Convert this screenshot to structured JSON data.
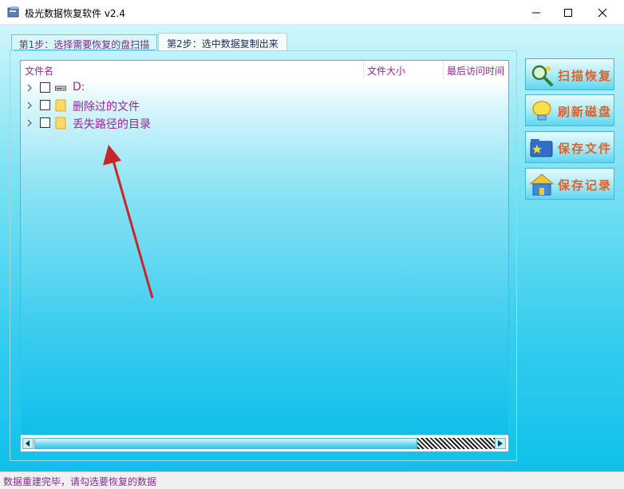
{
  "window": {
    "title": "极光数据恢复软件 v2.4",
    "icons": {
      "app": "app-icon",
      "minimize": "minimize-icon",
      "maximize": "maximize-icon",
      "close": "close-icon"
    }
  },
  "tabs": [
    {
      "label": "第1步：选择需要恢复的盘扫描",
      "active": false
    },
    {
      "label": "第2步：选中数据复制出来",
      "active": true
    }
  ],
  "tree": {
    "columns": [
      "文件名",
      "文件大小",
      "最后访问时间"
    ],
    "rows": [
      {
        "label": "D:",
        "icon": "drive-icon",
        "checked": false
      },
      {
        "label": "删除过的文件",
        "icon": "folder-icon",
        "checked": false
      },
      {
        "label": "丢失路径的目录",
        "icon": "folder-icon",
        "checked": false
      }
    ]
  },
  "buttons": {
    "scan": {
      "label": "扫描恢复",
      "icon": "magnifier-icon"
    },
    "refresh": {
      "label": "刷新磁盘",
      "icon": "bulb-icon"
    },
    "save_file": {
      "label": "保存文件",
      "icon": "folder-star-icon"
    },
    "save_record": {
      "label": "保存记录",
      "icon": "house-icon"
    }
  },
  "status": {
    "text": "数据重建完毕，请勾选要恢复的数据"
  },
  "colors": {
    "accent_text": "#a020a0",
    "button_text": "#e0622a",
    "arrow": "#c8262a"
  }
}
